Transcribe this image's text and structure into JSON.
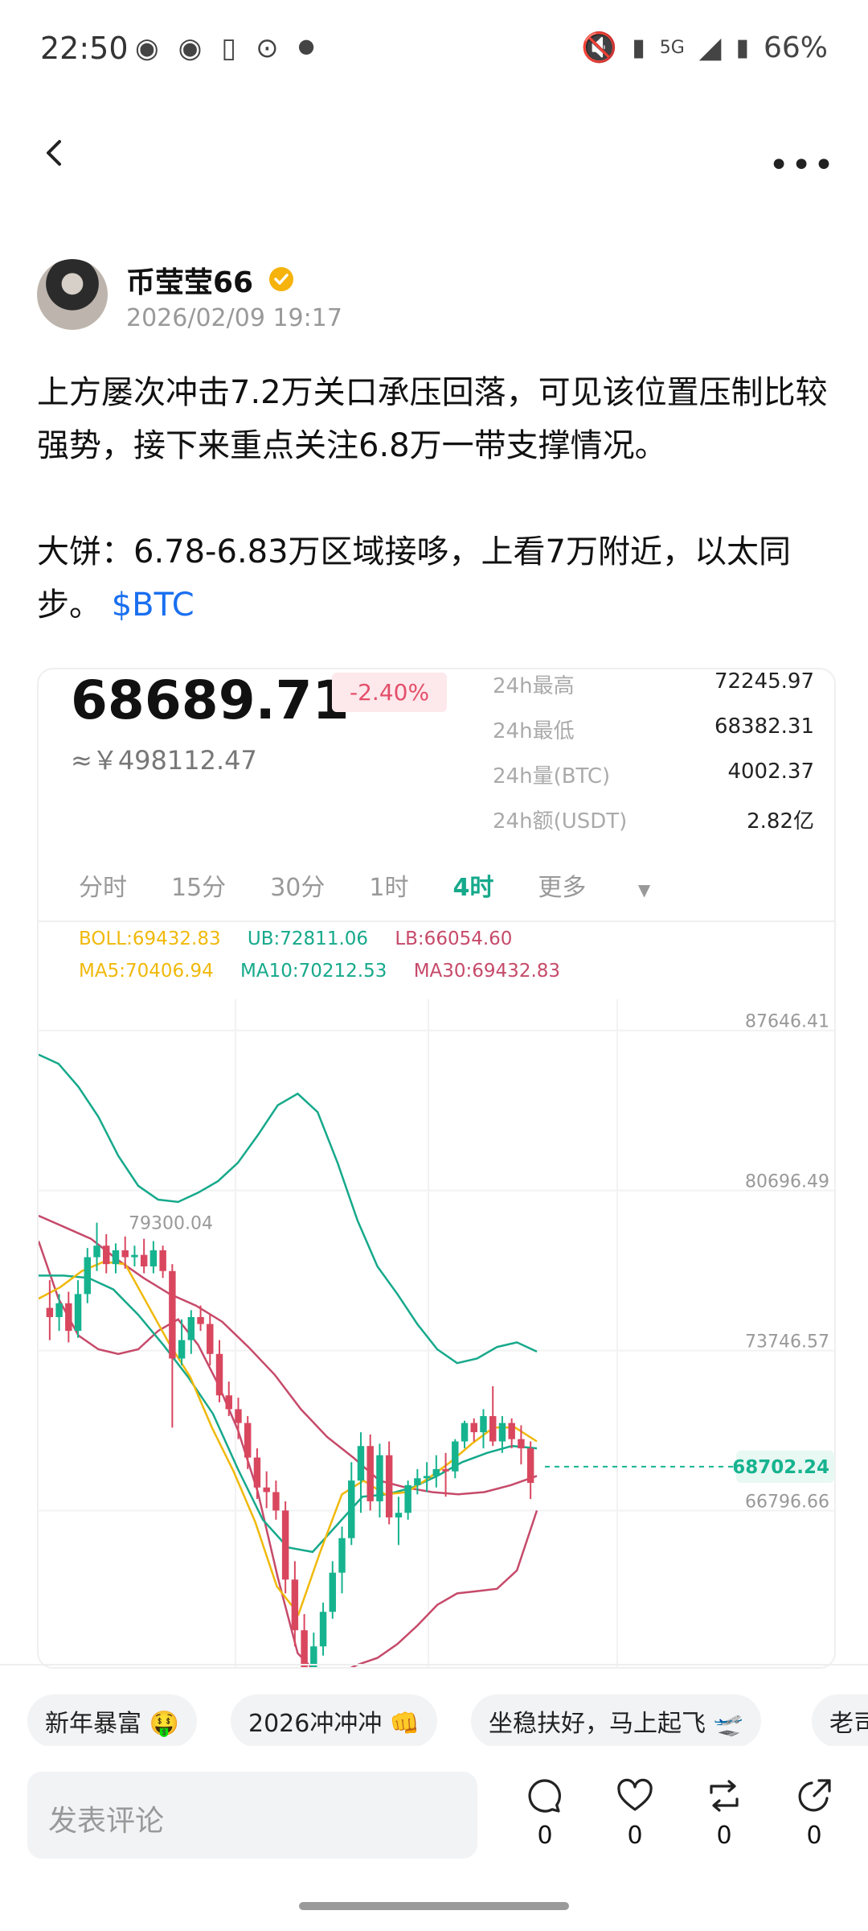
{
  "status": {
    "time": "22:50",
    "battery": "66%",
    "network": "5G"
  },
  "author": {
    "name": "币莹莹66",
    "time": "2026/02/09 19:17"
  },
  "post": {
    "paragraph1": "上方屡次冲击7.2万关口承压回落，可见该位置压制比较强势，接下来重点关注6.8万一带支撑情况。",
    "paragraph2": "大饼：6.78-6.83万区域接哆，上看7万附近，以太同步。",
    "tag": "$BTC"
  },
  "market": {
    "price": "68689.71",
    "change": "-2.40%",
    "cny": "≈￥498112.47",
    "stats": [
      {
        "label": "24h最高",
        "value": "72245.97"
      },
      {
        "label": "24h最低",
        "value": "68382.31"
      },
      {
        "label": "24h量(BTC)",
        "value": "4002.37"
      },
      {
        "label": "24h额(USDT)",
        "value": "2.82亿"
      }
    ],
    "intervals": [
      "分时",
      "15分",
      "30分",
      "1时",
      "4时",
      "更多"
    ],
    "active_interval": "4时",
    "legend": {
      "boll": "BOLL:69432.83",
      "ub": "UB:72811.06",
      "lb": "LB:66054.60",
      "ma5": "MA5:70406.94",
      "ma10": "MA10:70212.53",
      "ma30": "MA30:69432.83"
    },
    "colors": {
      "up": "#16b38f",
      "down": "#d9475f",
      "ma5": "#f0b90b",
      "ma10": "#16a98b",
      "ma30": "#c64a6a"
    }
  },
  "chart_data": {
    "type": "candlestick",
    "y_ticks": [
      "87646.41",
      "80696.49",
      "73746.57",
      "66796.66"
    ],
    "current_price_label": "68702.24",
    "high_marker": "79300.04",
    "ylim": [
      60000,
      89000
    ],
    "candles": [
      [
        75600,
        76800,
        74200,
        75200
      ],
      [
        75200,
        76200,
        74600,
        75800
      ],
      [
        75800,
        76300,
        74100,
        74600
      ],
      [
        74600,
        76800,
        74300,
        76200
      ],
      [
        76200,
        78200,
        75800,
        77800
      ],
      [
        77800,
        79300,
        77200,
        78300
      ],
      [
        78300,
        78800,
        77100,
        77500
      ],
      [
        77500,
        78400,
        77100,
        78100
      ],
      [
        78100,
        78700,
        77300,
        77800
      ],
      [
        77800,
        78300,
        77400,
        77900
      ],
      [
        77900,
        78600,
        77100,
        77400
      ],
      [
        77400,
        78500,
        77100,
        78100
      ],
      [
        78100,
        78300,
        76900,
        77200
      ],
      [
        77200,
        77500,
        70400,
        73400
      ],
      [
        73400,
        75100,
        73100,
        74200
      ],
      [
        74200,
        75500,
        73600,
        75200
      ],
      [
        75200,
        75700,
        74600,
        74900
      ],
      [
        74900,
        75300,
        73100,
        73600
      ],
      [
        73600,
        74200,
        71500,
        71800
      ],
      [
        71800,
        72400,
        70900,
        71200
      ],
      [
        71200,
        71700,
        69900,
        70600
      ],
      [
        70600,
        70900,
        68600,
        69100
      ],
      [
        69100,
        69500,
        67300,
        67800
      ],
      [
        67800,
        68500,
        66900,
        67600
      ],
      [
        67600,
        68100,
        66400,
        66800
      ],
      [
        66800,
        67200,
        63200,
        63800
      ],
      [
        63800,
        64600,
        60900,
        61600
      ],
      [
        61600,
        62300,
        58600,
        59700
      ],
      [
        59700,
        61500,
        57200,
        60900
      ],
      [
        60900,
        62800,
        60500,
        62400
      ],
      [
        62400,
        64600,
        62100,
        64100
      ],
      [
        64100,
        66100,
        63200,
        65600
      ],
      [
        65600,
        68900,
        65300,
        68100
      ],
      [
        68100,
        70200,
        66700,
        69600
      ],
      [
        69600,
        70100,
        66800,
        67200
      ],
      [
        67200,
        69700,
        66500,
        69200
      ],
      [
        69200,
        69800,
        66200,
        66500
      ],
      [
        66500,
        67400,
        65300,
        66700
      ],
      [
        66700,
        68100,
        66400,
        67900
      ],
      [
        67900,
        68600,
        67500,
        68200
      ],
      [
        68200,
        68900,
        67600,
        68300
      ],
      [
        68300,
        69200,
        67800,
        68600
      ],
      [
        68600,
        69300,
        67400,
        68500
      ],
      [
        68500,
        69900,
        68200,
        69800
      ],
      [
        69800,
        70700,
        69500,
        70600
      ],
      [
        70600,
        70800,
        69800,
        70200
      ],
      [
        70200,
        71200,
        69500,
        70900
      ],
      [
        70900,
        72200,
        69600,
        69800
      ],
      [
        69800,
        70900,
        69300,
        70600
      ],
      [
        70600,
        70800,
        69500,
        69900
      ],
      [
        69900,
        70500,
        68800,
        69500
      ],
      [
        69500,
        69800,
        67300,
        68000
      ]
    ],
    "ub_values": [
      86600,
      86200,
      85200,
      83900,
      82200,
      80900,
      80300,
      80200,
      80600,
      81100,
      81900,
      83100,
      84400,
      84900,
      84100,
      81900,
      79400,
      77400,
      76200,
      74900,
      73800,
      73200,
      73400,
      73900,
      74100,
      73700
    ],
    "lb_values": [
      78500,
      76000,
      74400,
      73800,
      73600,
      73800,
      74600,
      75100,
      74000,
      72300,
      70300,
      67600,
      63900,
      60600,
      59700,
      59700,
      60100,
      60400,
      61000,
      61800,
      62700,
      63200,
      63300,
      63400,
      64200,
      66800
    ],
    "ma5_values": [
      76000,
      76500,
      77200,
      77600,
      77500,
      75800,
      74100,
      72600,
      70400,
      68500,
      66300,
      63500,
      62300,
      65000,
      67500,
      68100,
      67500,
      67600,
      68200,
      68900,
      69700,
      70400,
      70400,
      69800
    ],
    "ma10_values": [
      77000,
      77000,
      76900,
      76400,
      75300,
      74000,
      72600,
      71000,
      68600,
      66400,
      65200,
      65000,
      66200,
      67400,
      67500,
      67800,
      68300,
      68900,
      69300,
      69600,
      69500
    ],
    "ma30_values": [
      79600,
      79100,
      78600,
      77700,
      76900,
      76200,
      75700,
      75000,
      73900,
      72700,
      71200,
      70000,
      69100,
      68100,
      67800,
      67600,
      67500,
      67600,
      67900,
      68300
    ]
  },
  "topics": [
    "新年暴富 🤑",
    "2026冲冲冲 👊",
    "坐稳扶好，马上起飞 🛫",
    "老司"
  ],
  "comment": {
    "placeholder": "发表评论"
  },
  "actions": [
    {
      "name": "comment",
      "count": "0"
    },
    {
      "name": "like",
      "count": "0"
    },
    {
      "name": "repost",
      "count": "0"
    },
    {
      "name": "share",
      "count": "0"
    }
  ]
}
